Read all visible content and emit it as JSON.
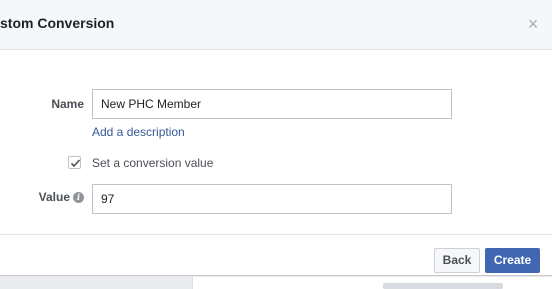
{
  "dialog": {
    "title": "stom Conversion",
    "close_glyph": "×",
    "close_icon": "close-icon"
  },
  "form": {
    "name_label": "Name",
    "name_value": "New PHC Member",
    "add_description_link": "Add a description",
    "conversion_checkbox_checked": true,
    "conversion_checkbox_label": "Set a conversion value",
    "value_label": "Value",
    "value_info_glyph": "i",
    "value_info_icon": "info-icon",
    "value_value": "97"
  },
  "footer": {
    "back_label": "Back",
    "create_label": "Create"
  },
  "colors": {
    "primary_button": "#4267b2",
    "link": "#365899",
    "header_bg": "#f6f7f9"
  }
}
